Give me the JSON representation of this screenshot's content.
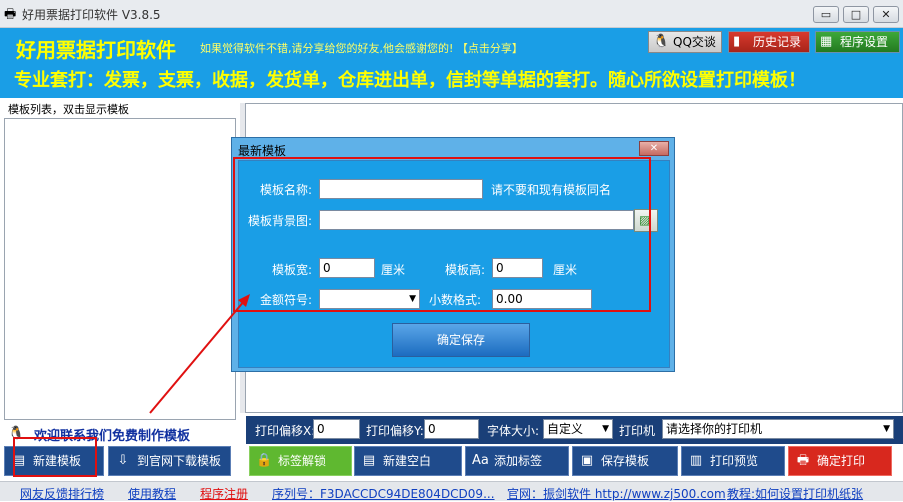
{
  "window": {
    "title": "好用票据打印软件  V3.8.5",
    "controls": [
      "▭",
      "□",
      "✕"
    ]
  },
  "banner": {
    "app_name": "好用票据打印软件",
    "share_text": "如果觉得软件不错,请分享给您的好友,他会感谢您的! 【点击分享】",
    "slogan": "专业套打：发票，支票，收据，发货单，仓库进出单，信封等单据的套打。随心所欲设置打印模板！",
    "qq_label": "QQ交谈",
    "history_label": "历史记录",
    "settings_label": "程序设置"
  },
  "left": {
    "header": "模板列表，双击显示模板",
    "welcome": "欢迎联系我们免费制作模板",
    "new_template_label": "新建模板",
    "download_label": "到官网下载模板"
  },
  "printbar": {
    "offset_x_label": "打印偏移X:",
    "offset_x_value": "0",
    "offset_y_label": "打印偏移Y:",
    "offset_y_value": "0",
    "font_size_label": "字体大小:",
    "font_size_value": "自定义",
    "printer_label": "打印机",
    "printer_value": "请选择你的打印机"
  },
  "toolbar": {
    "unlock_label": "标签解锁",
    "new_blank_label": "新建空白",
    "add_label_label": "添加标签",
    "save_template_label": "保存模板",
    "preview_label": "打印预览",
    "print_label": "确定打印"
  },
  "statusbar": {
    "feedback": "网友反馈排行榜",
    "tutorial": "使用教程",
    "register": "程序注册",
    "serial": "序列号：F3DACCDC94DE804DCD09...",
    "website": "官网：振剑软件 http://www.zj500.com",
    "tutorial2": "教程:如何设置打印机纸张"
  },
  "dialog": {
    "title": "最新模板",
    "close": "✕",
    "name_label": "模板名称:",
    "name_value": "",
    "name_hint": "请不要和现有模板同名",
    "bg_label": "模板背景图:",
    "bg_value": "",
    "width_label": "模板宽:",
    "width_value": "0",
    "width_unit": "厘米",
    "height_label": "模板高:",
    "height_value": "0",
    "height_unit": "厘米",
    "currency_label": "金额符号:",
    "currency_value": "",
    "decimal_label": "小数格式:",
    "decimal_value": "0.00",
    "save_label": "确定保存"
  },
  "colors": {
    "banner": "#1a9ee6",
    "highlight": "#e01010",
    "slogan": "#ffff00"
  }
}
